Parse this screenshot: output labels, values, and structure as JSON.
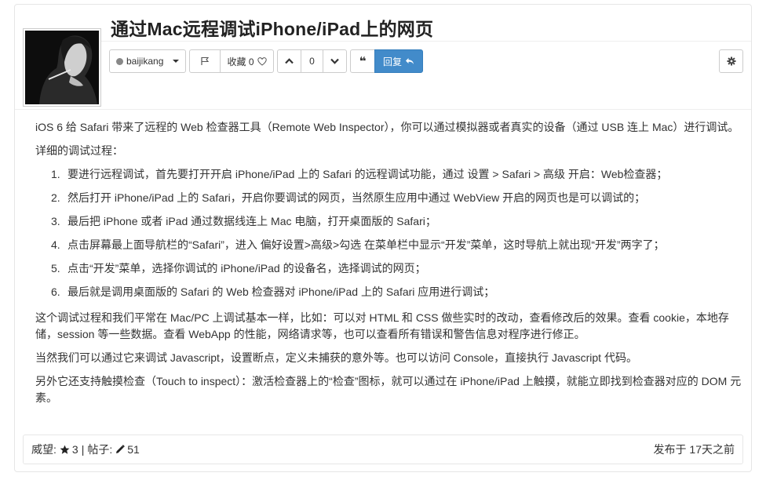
{
  "post": {
    "title": "通过Mac远程调试iPhone/iPad上的网页"
  },
  "toolbar": {
    "user_label": "baijikang",
    "favorite_label": "收藏 0",
    "vote_count": "0",
    "reply_label": "回复"
  },
  "content": {
    "para1": "iOS 6 给 Safari 带来了远程的 Web 检查器工具（Remote Web Inspector），你可以通过模拟器或者真实的设备（通过 USB 连上 Mac）进行调试。",
    "para2": "详细的调试过程：",
    "steps": [
      {
        "num": "1.",
        "text": "要进行远程调试，首先要打开开启 iPhone/iPad 上的 Safari 的远程调试功能，通过 设置 > Safari > 高级 开启：Web检查器；"
      },
      {
        "num": "2.",
        "text": "然后打开 iPhone/iPad 上的 Safari，开启你要调试的网页，当然原生应用中通过 WebView 开启的网页也是可以调试的；"
      },
      {
        "num": "3.",
        "text": "最后把 iPhone 或者 iPad 通过数据线连上 Mac 电脑，打开桌面版的 Safari；"
      },
      {
        "num": "4.",
        "text": "点击屏幕最上面导航栏的“Safari”，进入 偏好设置>高级>勾选 在菜单栏中显示“开发”菜单，这时导航上就出现“开发”两字了；"
      },
      {
        "num": "5.",
        "text": "点击“开发”菜单，选择你调试的 iPhone/iPad 的设备名，选择调试的网页；"
      },
      {
        "num": "6.",
        "text": "最后就是调用桌面版的 Safari 的 Web 检查器对 iPhone/iPad 上的 Safari 应用进行调试；"
      }
    ],
    "para3": "这个调试过程和我们平常在 Mac/PC 上调试基本一样，比如：可以对 HTML 和 CSS 做些实时的改动，查看修改后的效果。查看 cookie，本地存储，session 等一些数据。查看 WebApp 的性能，网络请求等，也可以查看所有错误和警告信息对程序进行修正。",
    "para4": "当然我们可以通过它来调试 Javascript，设置断点，定义未捕获的意外等。也可以访问 Console，直接执行 Javascript 代码。",
    "para5": "另外它还支持触摸检查（Touch to inspect）：激活检查器上的“检查”图标，就可以通过在 iPhone/iPad 上触摸，就能立即找到检查器对应的 DOM 元素。"
  },
  "footer": {
    "reputation_label": "威望:",
    "reputation_value": "3",
    "separator": "|",
    "posts_label": "帖子:",
    "posts_value": "51",
    "published": "发布于 17天之前"
  },
  "icons": {
    "user_status": "status-dot-icon",
    "flag": "flag-icon",
    "heart": "heart-icon",
    "up": "chevron-up-icon",
    "down": "chevron-down-icon",
    "quote": "quote-icon",
    "reply": "reply-arrow-icon",
    "settings": "gear-icon",
    "star": "star-icon",
    "pencil": "pencil-icon"
  },
  "colors": {
    "reply_button": "#428bca",
    "border": "#e6e6e6"
  }
}
